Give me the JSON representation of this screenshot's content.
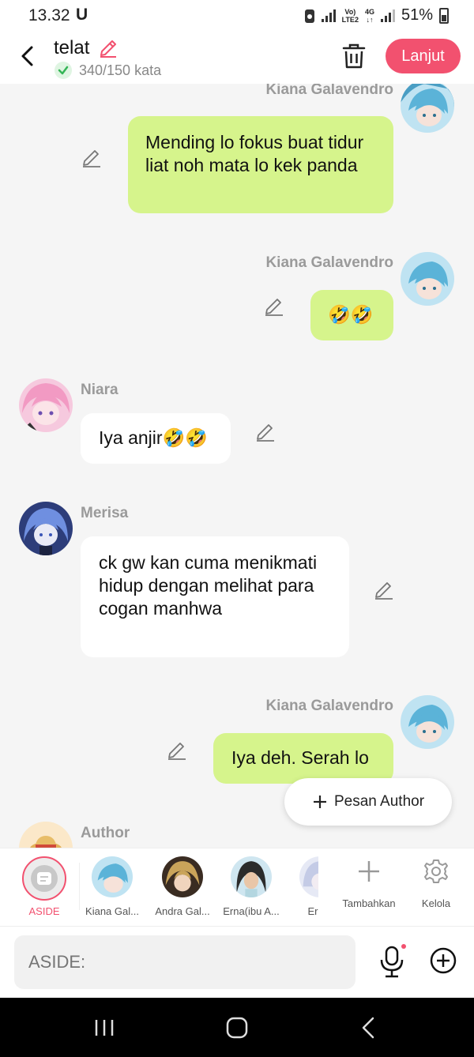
{
  "status_bar": {
    "time": "13.32",
    "carrier_glyph": "U",
    "volte_label": "Vo)\nLTE2",
    "network": "4G",
    "battery": "51%"
  },
  "header": {
    "title": "telat",
    "word_count": "340/150 kata",
    "continue_label": "Lanjut"
  },
  "messages": [
    {
      "sender": "Kiana Galavendro",
      "text": "Mending lo fokus buat tidur liat noh mata lo kek panda",
      "side": "right"
    },
    {
      "sender": "Kiana Galavendro",
      "text": "🤣🤣",
      "side": "right"
    },
    {
      "sender": "Niara",
      "text": "Iya anjir🤣🤣",
      "side": "left"
    },
    {
      "sender": "Merisa",
      "text": "ck gw kan cuma menikmati hidup dengan melihat para cogan manhwa",
      "side": "left"
    },
    {
      "sender": "Kiana Galavendro",
      "text": "Iya deh. Serah lo",
      "side": "right"
    },
    {
      "sender": "Author",
      "text": "",
      "side": "left"
    }
  ],
  "floating_button": {
    "label": "Pesan Author"
  },
  "characters": [
    {
      "label": "ASIDE",
      "active": true
    },
    {
      "label": "Kiana Gal..."
    },
    {
      "label": "Andra Gal..."
    },
    {
      "label": "Erna(ibu A..."
    },
    {
      "label": "Er"
    },
    {
      "label": "Tambahkan"
    },
    {
      "label": "Kelola"
    }
  ],
  "input": {
    "placeholder": "ASIDE:"
  },
  "colors": {
    "accent": "#f2516f",
    "my_bubble": "#d6f48c",
    "their_bubble": "#ffffff",
    "background": "#f5f5f5"
  }
}
